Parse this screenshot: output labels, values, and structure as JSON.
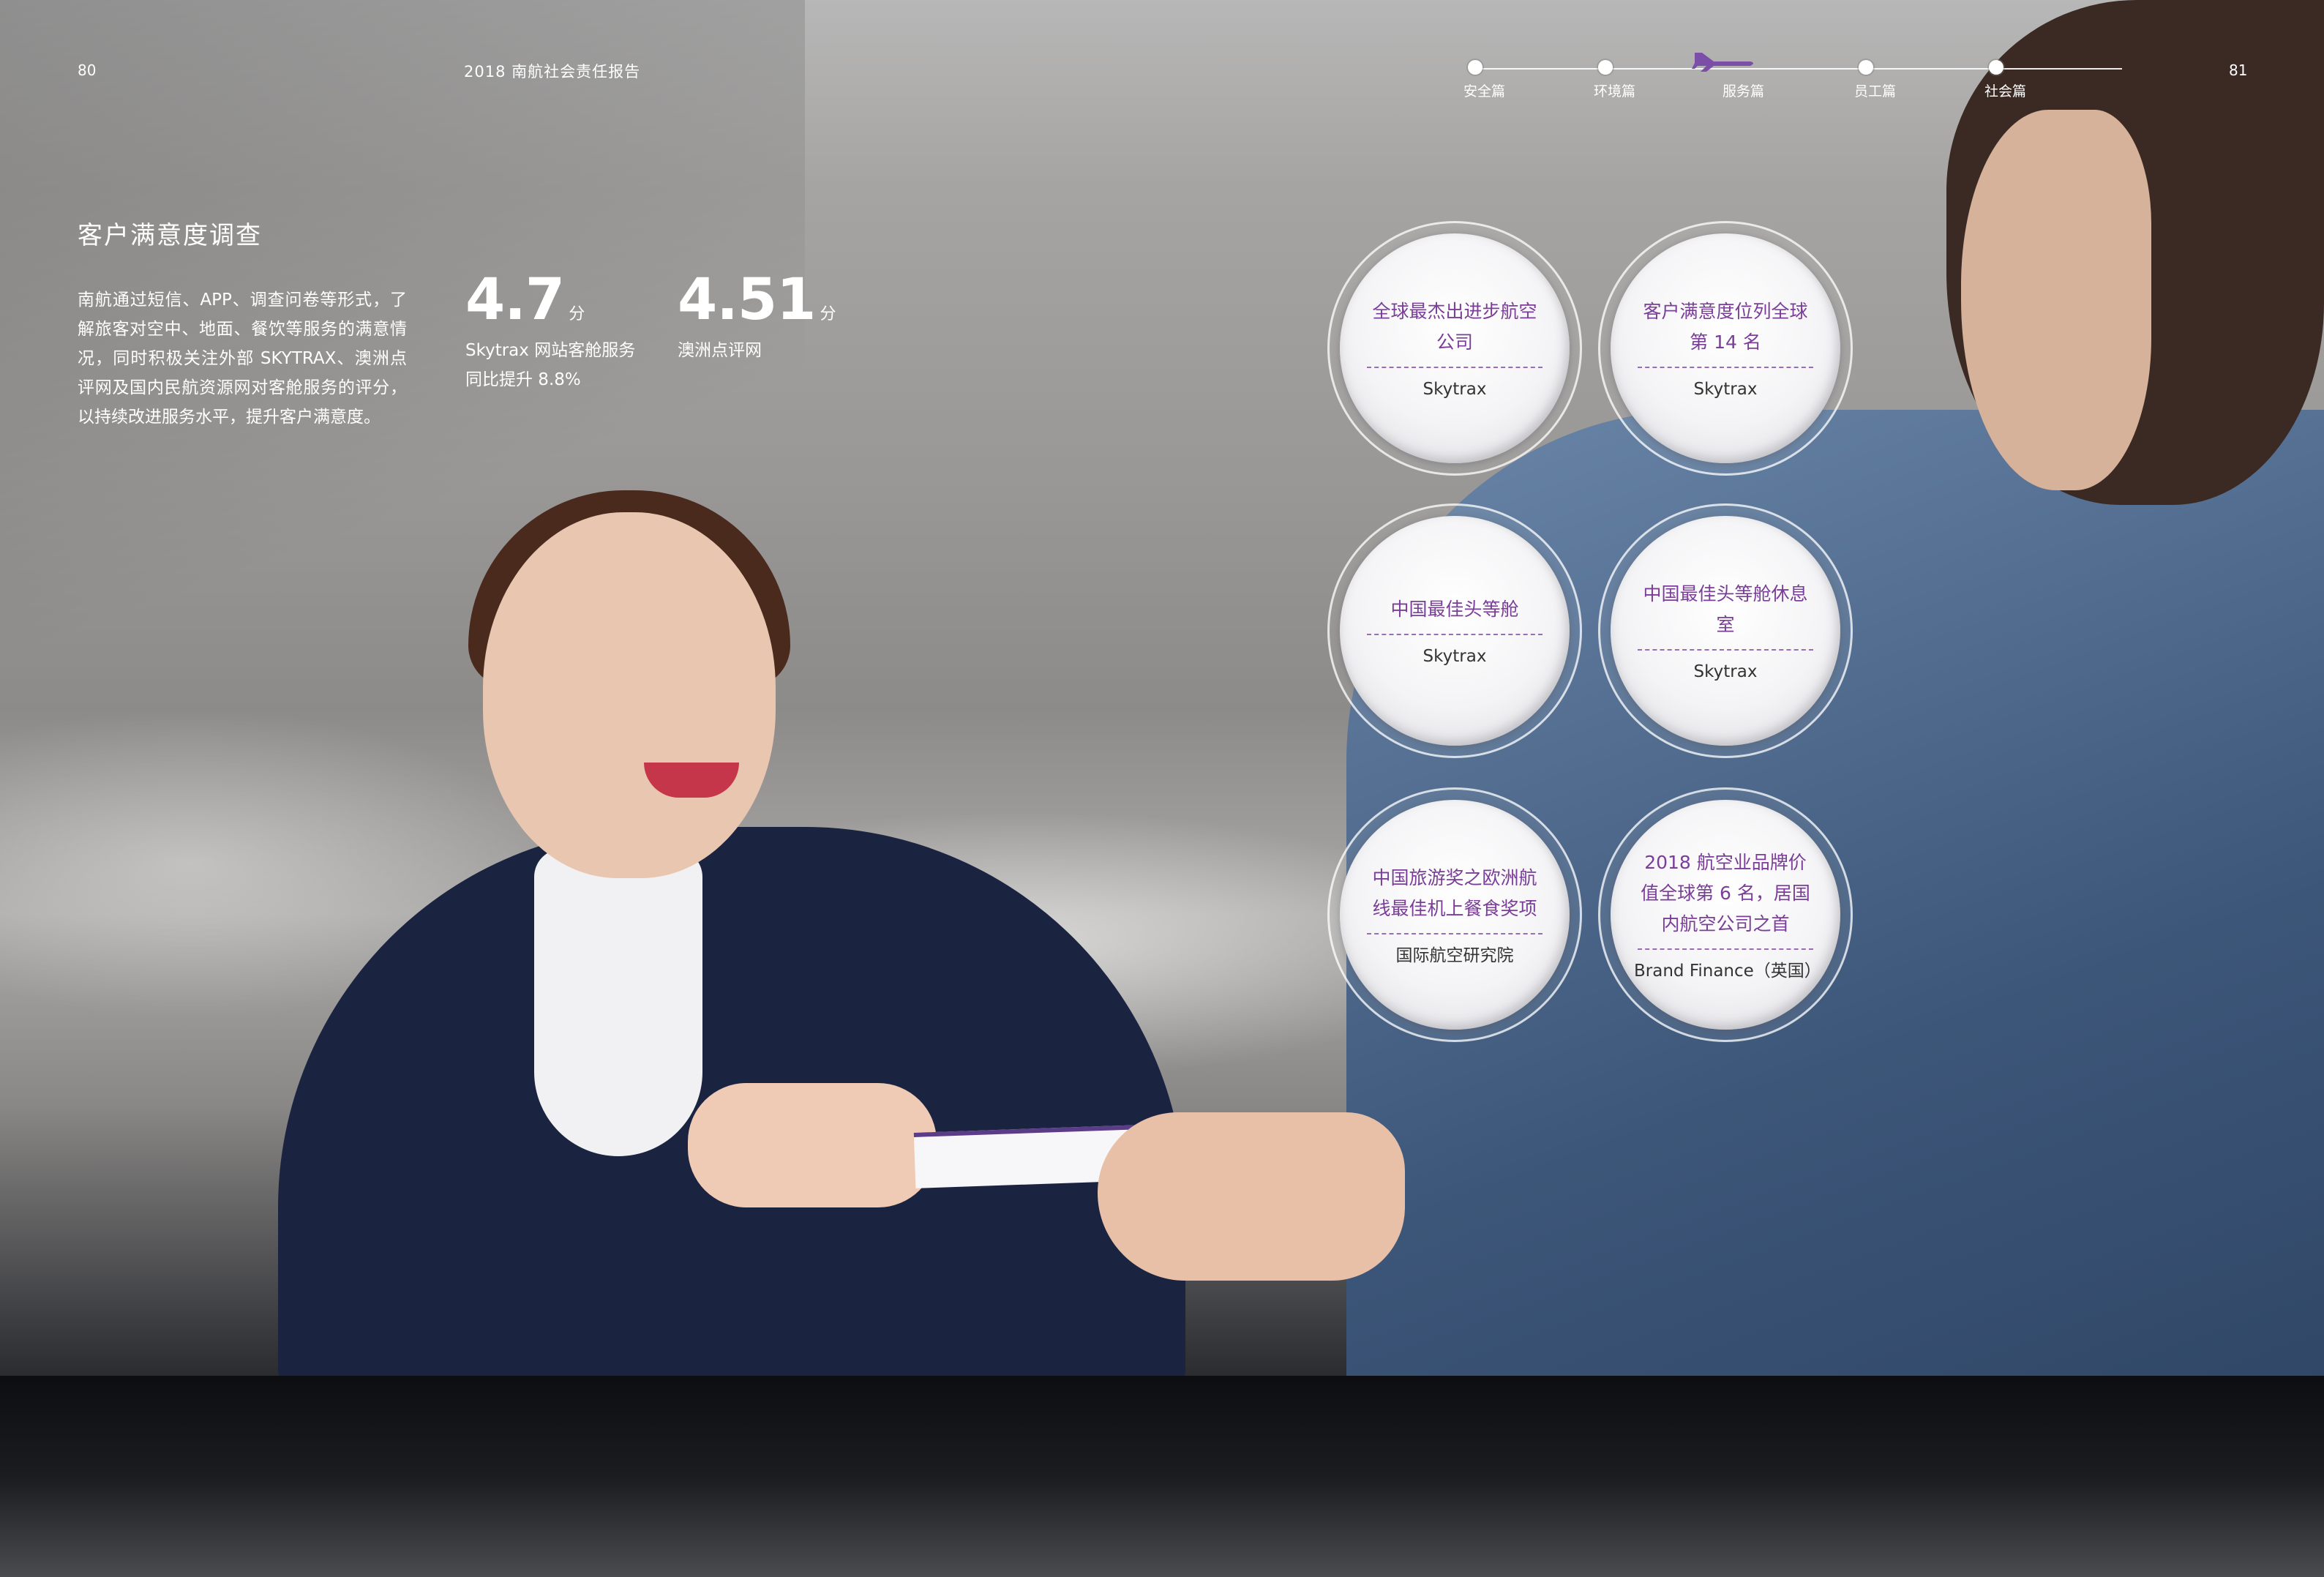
{
  "header": {
    "page_left": "80",
    "page_right": "81",
    "report_title": "2018 南航社会责任报告",
    "nav": [
      {
        "label": "安全篇",
        "active": false
      },
      {
        "label": "环境篇",
        "active": false
      },
      {
        "label": "服务篇",
        "active": true
      },
      {
        "label": "员工篇",
        "active": false
      },
      {
        "label": "社会篇",
        "active": false
      }
    ]
  },
  "section": {
    "title": "客户满意度调查",
    "body": "南航通过短信、APP、调查问卷等形式，了解旅客对空中、地面、餐饮等服务的满意情况，同时积极关注外部 SKYTRAX、澳洲点评网及国内民航资源网对客舱服务的评分，以持续改进服务水平，提升客户满意度。"
  },
  "stats": [
    {
      "value": "4.7",
      "unit": "分",
      "label_line1": "Skytrax 网站客舱服务",
      "label_line2": "同比提升 8.8%"
    },
    {
      "value": "4.51",
      "unit": "分",
      "label_line1": "澳洲点评网",
      "label_line2": ""
    }
  ],
  "awards": [
    {
      "name": "全球最杰出进步航空公司",
      "source": "Skytrax"
    },
    {
      "name": "客户满意度位列全球第 14 名",
      "source": "Skytrax"
    },
    {
      "name": "中国最佳头等舱",
      "source": "Skytrax"
    },
    {
      "name": "中国最佳头等舱休息室",
      "source": "Skytrax"
    },
    {
      "name": "中国旅游奖之欧洲航线最佳机上餐食奖项",
      "source": "国际航空研究院"
    },
    {
      "name": "2018 航空业品牌价值全球第 6 名，居国内航空公司之首",
      "source": "Brand Finance（英国）"
    }
  ],
  "colors": {
    "accent_purple": "#7a3d98",
    "nav_plane": "#7b4fa8",
    "text_white": "#ffffff"
  }
}
